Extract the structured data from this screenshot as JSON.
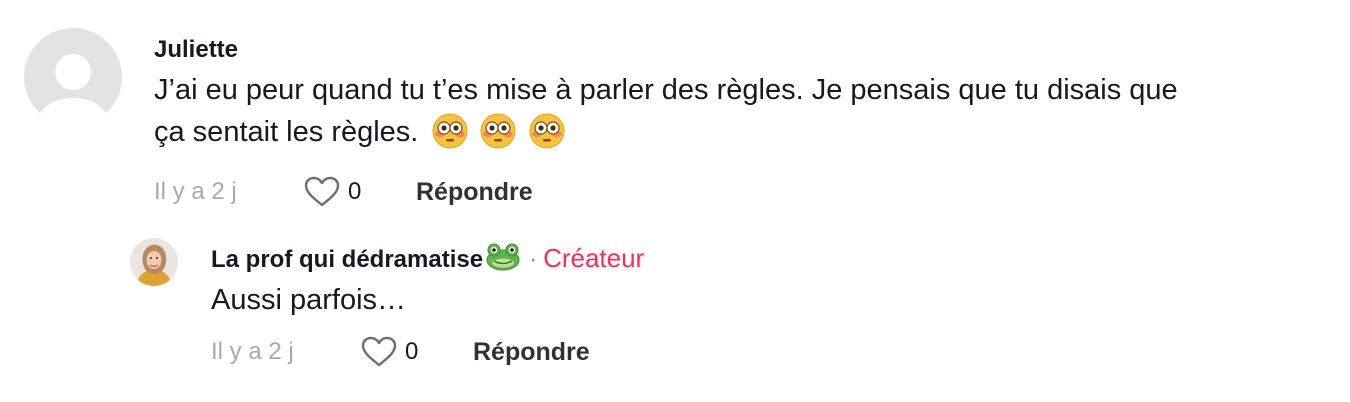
{
  "comments": [
    {
      "username": "Juliette",
      "text_line1": "J’ai eu peur quand tu t’es mise à parler des règles. Je pensais que tu disais que",
      "text_line2": "ça sentait les règles.",
      "emojis": [
        "flushed-face",
        "flushed-face",
        "flushed-face"
      ],
      "time": "Il y a 2 j",
      "likes": "0",
      "reply_label": "Répondre"
    },
    {
      "username": "La prof qui dédramatise",
      "username_emoji": "frog-face",
      "separator": "·",
      "badge": "Créateur",
      "text": "Aussi parfois…",
      "time": "Il y a 2 j",
      "likes": "0",
      "reply_label": "Répondre"
    }
  ],
  "colors": {
    "creator_badge": "#fe2c55",
    "meta_text": "#a7a8ac",
    "primary_text": "#161823"
  }
}
